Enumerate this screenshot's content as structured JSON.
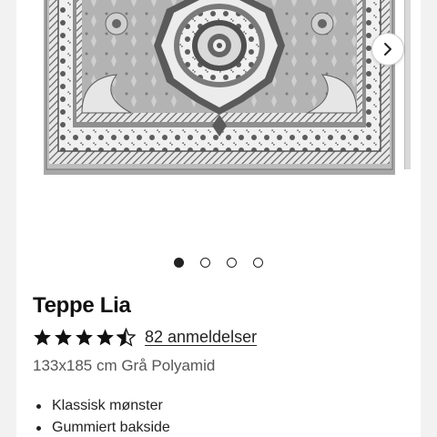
{
  "product": {
    "name": "Teppe Lia",
    "rating": 4.5,
    "rating_max": 5,
    "reviews_label": "82 anmeldelser",
    "description": "133x185 cm Grå Polyamid",
    "features": [
      "Klassisk mønster",
      "Gummiert bakside"
    ]
  },
  "gallery": {
    "image_count": 4,
    "active_index": 0,
    "next_icon": "chevron-right-icon"
  },
  "colors": {
    "rug_base": "#a8a8a8",
    "rug_light": "#e6e6e6",
    "rug_dark": "#595959",
    "text": "#111111",
    "muted": "#555555"
  }
}
